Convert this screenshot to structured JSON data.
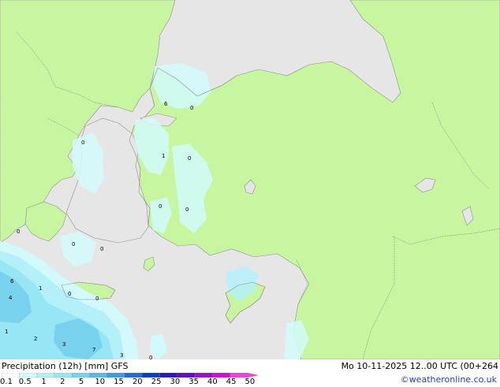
{
  "title": "Precipitation (12h) [mm] GFS",
  "run_info": "Mo 10-11-2025 12..00 UTC (00+264",
  "credit": "©weatheronline.co.uk",
  "legend": {
    "ticks": [
      "0.1",
      "0.5",
      "1",
      "2",
      "5",
      "10",
      "15",
      "20",
      "25",
      "30",
      "35",
      "40",
      "45",
      "50"
    ],
    "colors": [
      "#ffffff",
      "#d2fafc",
      "#b4f0fa",
      "#96e6f5",
      "#78d2ee",
      "#5ab9e6",
      "#3c9ede",
      "#1e6fd2",
      "#0a3fc0",
      "#2a18b8",
      "#6010c0",
      "#9a10c8",
      "#d010d0",
      "#f040e0"
    ]
  },
  "map_colors": {
    "sea": "#e6e6e6",
    "land": "#c8f5a0",
    "border": "#909090"
  },
  "point_labels": [
    "6",
    "0",
    "0",
    "1",
    "0",
    "0",
    "0",
    "0",
    "0",
    "0",
    "6",
    "1",
    "4",
    "1",
    "0",
    "0",
    "2",
    "3",
    "7",
    "3",
    "0"
  ]
}
